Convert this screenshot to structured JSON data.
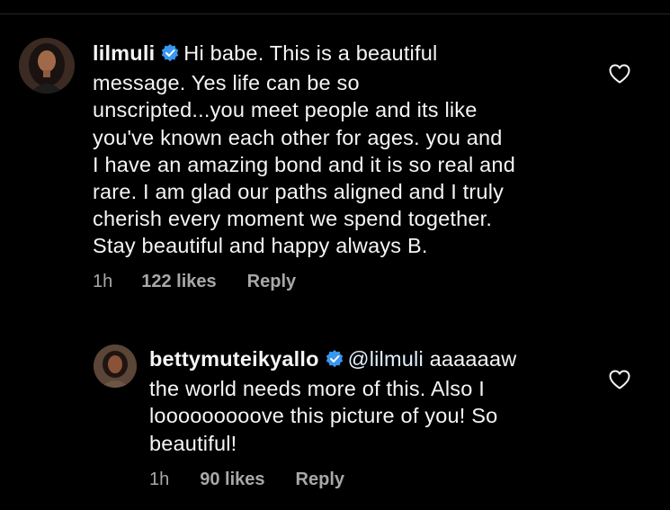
{
  "colors": {
    "background": "#000000",
    "text": "#f5f5f5",
    "meta": "#a8a8a8",
    "verified": "#3897f0"
  },
  "comments": [
    {
      "username": "lilmuli",
      "verified": true,
      "lines": [
        "Hi babe. This is a beautiful",
        "message. Yes life can be so",
        "unscripted...you meet people and its like",
        "you've known each other for ages. you and",
        "I have an amazing bond and it is so real and",
        "rare. I am glad our paths aligned and I truly",
        "cherish every moment we spend together.",
        "Stay beautiful and happy always B."
      ],
      "time": "1h",
      "likes": "122 likes",
      "reply_label": "Reply",
      "like_icon": "heart-outline-icon"
    },
    {
      "username": "bettymuteikyallo",
      "verified": true,
      "mention": "@lilmuli",
      "lines": [
        " aaaaaaw",
        "the world needs more of this. Also I",
        "looooooooove this picture of you! So",
        "beautiful!"
      ],
      "time": "1h",
      "likes": "90 likes",
      "reply_label": "Reply",
      "like_icon": "heart-outline-icon"
    }
  ]
}
